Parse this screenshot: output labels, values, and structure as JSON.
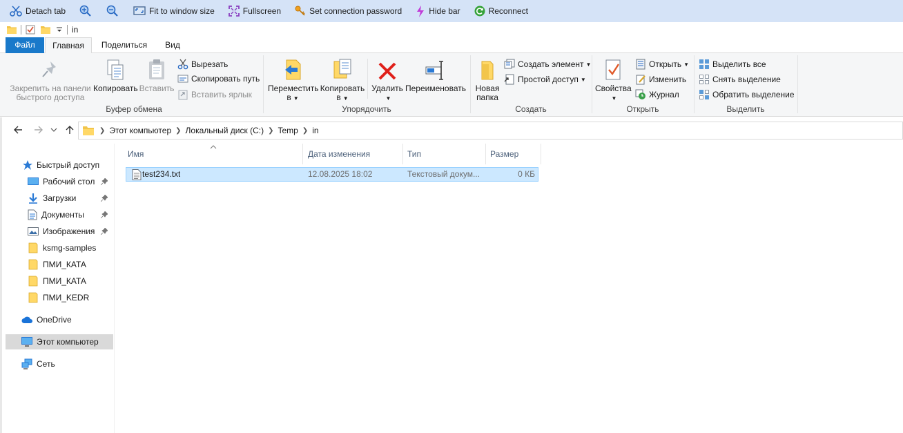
{
  "topbar": {
    "items": [
      {
        "label": "Detach tab",
        "icon": "scissors-icon"
      },
      {
        "label": "",
        "icon": "zoom-in-icon"
      },
      {
        "label": "",
        "icon": "zoom-out-icon"
      },
      {
        "label": "Fit to window size",
        "icon": "fit-window-icon"
      },
      {
        "label": "Fullscreen",
        "icon": "fullscreen-icon"
      },
      {
        "label": "Set connection password",
        "icon": "key-icon"
      },
      {
        "label": "Hide bar",
        "icon": "lightning-icon"
      },
      {
        "label": "Reconnect",
        "icon": "reconnect-icon"
      }
    ]
  },
  "qat": {
    "title": "in"
  },
  "tabs": {
    "file": "Файл",
    "home": "Главная",
    "share": "Поделиться",
    "view": "Вид"
  },
  "ribbon": {
    "clipboard": {
      "pin": "Закрепить на панели быстрого доступа",
      "pin_l1": "Закрепить на панели",
      "pin_l2": "быстрого доступа",
      "copy": "Копировать",
      "paste": "Вставить",
      "cut": "Вырезать",
      "copy_path": "Скопировать путь",
      "paste_shortcut": "Вставить ярлык",
      "label": "Буфер обмена"
    },
    "organize": {
      "move_l1": "Переместить",
      "move_l2": "в",
      "copy_l1": "Копировать",
      "copy_l2": "в",
      "delete": "Удалить",
      "rename": "Переименовать",
      "label": "Упорядочить"
    },
    "create": {
      "new_folder_l1": "Новая",
      "new_folder_l2": "папка",
      "new_item": "Создать элемент",
      "easy_access": "Простой доступ",
      "label": "Создать"
    },
    "open": {
      "properties": "Свойства",
      "open": "Открыть",
      "edit": "Изменить",
      "history": "Журнал",
      "label": "Открыть"
    },
    "select": {
      "select_all": "Выделить все",
      "select_none": "Снять выделение",
      "invert": "Обратить выделение",
      "label": "Выделить"
    }
  },
  "address": {
    "crumbs": [
      "Этот компьютер",
      "Локальный диск (C:)",
      "Temp",
      "in"
    ]
  },
  "nav": {
    "quick_access": "Быстрый доступ",
    "items": [
      "Рабочий стол",
      "Загрузки",
      "Документы",
      "Изображения",
      "ksmg-samples",
      "ПМИ_КАТА",
      "ПМИ_КАТА",
      "ПМИ_KEDR"
    ],
    "onedrive": "OneDrive",
    "this_pc": "Этот компьютер",
    "network": "Сеть"
  },
  "columns": {
    "name": "Имя",
    "modified": "Дата изменения",
    "type": "Тип",
    "size": "Размер"
  },
  "files": [
    {
      "name": "test234.txt",
      "modified": "12.08.2025 18:02",
      "type": "Текстовый докум...",
      "size": "0 КБ"
    }
  ],
  "colors": {
    "accent": "#1979ca",
    "selection": "#cce8ff",
    "topbar": "#d5e3f7"
  }
}
